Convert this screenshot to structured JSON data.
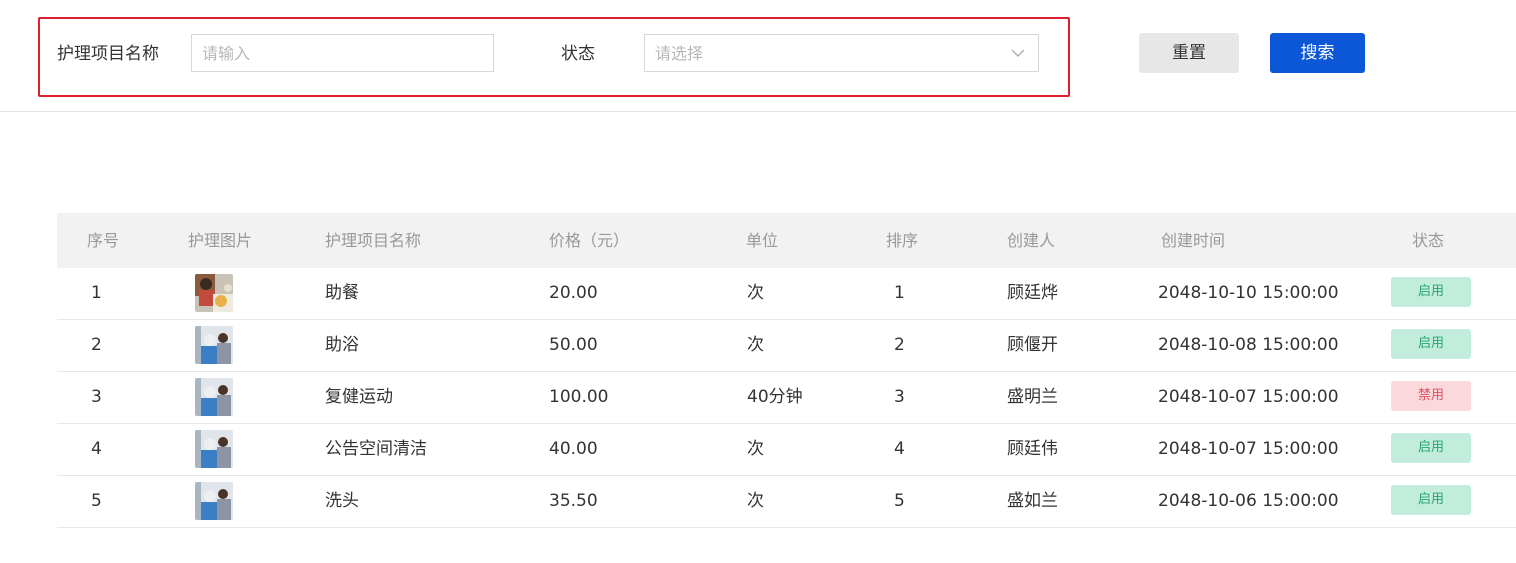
{
  "filter": {
    "name_label": "护理项目名称",
    "name_placeholder": "请输入",
    "status_label": "状态",
    "status_placeholder": "请选择",
    "reset_label": "重置",
    "search_label": "搜索"
  },
  "table": {
    "headers": {
      "index": "序号",
      "image": "护理图片",
      "name": "护理项目名称",
      "price": "价格（元）",
      "unit": "单位",
      "sort": "排序",
      "creator": "创建人",
      "created_at": "创建时间",
      "status": "状态"
    },
    "rows": [
      {
        "index": "1",
        "name": "助餐",
        "price": "20.00",
        "unit": "次",
        "sort": "1",
        "creator": "顾廷烨",
        "created_at": "2048-10-10 15:00:00",
        "status": "启用",
        "status_type": "enabled",
        "photo": "meal-photo"
      },
      {
        "index": "2",
        "name": "助浴",
        "price": "50.00",
        "unit": "次",
        "sort": "2",
        "creator": "顾偃开",
        "created_at": "2048-10-08 15:00:00",
        "status": "启用",
        "status_type": "enabled",
        "photo": "care-photo"
      },
      {
        "index": "3",
        "name": "复健运动",
        "price": "100.00",
        "unit": "40分钟",
        "sort": "3",
        "creator": "盛明兰",
        "created_at": "2048-10-07 15:00:00",
        "status": "禁用",
        "status_type": "disabled",
        "photo": "care-photo"
      },
      {
        "index": "4",
        "name": "公告空间清洁",
        "price": "40.00",
        "unit": "次",
        "sort": "4",
        "creator": "顾廷伟",
        "created_at": "2048-10-07 15:00:00",
        "status": "启用",
        "status_type": "enabled",
        "photo": "care-photo"
      },
      {
        "index": "5",
        "name": "洗头",
        "price": "35.50",
        "unit": "次",
        "sort": "5",
        "creator": "盛如兰",
        "created_at": "2048-10-06 15:00:00",
        "status": "启用",
        "status_type": "enabled",
        "photo": "care-photo"
      }
    ]
  },
  "colors": {
    "enabled_bg": "#c2ecdc",
    "enabled_text": "#2aa372",
    "disabled_bg": "#fbd8dc",
    "disabled_text": "#e0505e",
    "primary": "#0b57d8",
    "highlight_border": "#e01f2d"
  },
  "icons": {
    "select_arrow": "chevron-down-icon"
  }
}
